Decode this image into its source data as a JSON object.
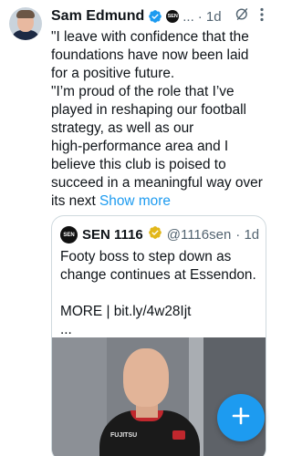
{
  "post": {
    "author_name": "Sam Edmund",
    "brand_badge": "SEN",
    "handle_truncated": "...",
    "time": "· 1d",
    "lines": [
      "\"I leave with confidence that the",
      "foundations have now been laid",
      "for a positive future.",
      "\"I’m proud of the role that I’ve",
      "played in reshaping our football",
      "strategy, as well as our",
      "high-performance area and I",
      "believe this club is poised to",
      "succeed in a meaningful way over"
    ],
    "last_line": "its next",
    "show_more": "Show more"
  },
  "quote": {
    "avatar_text": "SEN",
    "name": "SEN 1116",
    "handle": "@1116sen",
    "time": "· 1d",
    "lines": [
      "Footy boss to step down as",
      "change continues at Essendon."
    ],
    "link_line": "MORE | bit.ly/4w28Ijt",
    "ellipsis": "...",
    "image_shirt_text": "FUJITSU"
  },
  "icons": {
    "verified": "verified-icon",
    "grok": "grok-icon",
    "more": "more-vertical-icon",
    "compose": "plus-icon"
  },
  "colors": {
    "accent": "#1d9bf0",
    "verified_gold": "#e2b719",
    "text": "#0f1419",
    "muted": "#536471"
  }
}
